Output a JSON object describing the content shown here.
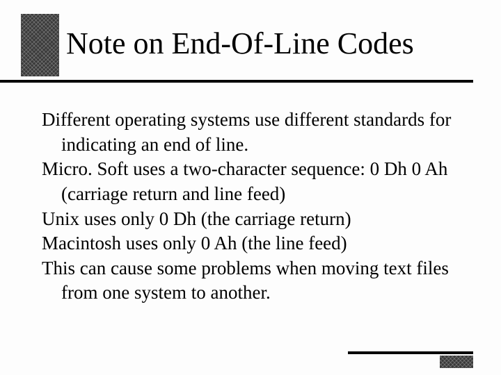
{
  "slide": {
    "title": "Note on End-Of-Line Codes",
    "paragraphs": [
      "Different operating systems use different standards for indicating an end of line.",
      "Micro. Soft uses a two-character sequence: 0 Dh 0 Ah (carriage return and line feed)",
      "Unix uses only 0 Dh (the carriage return)",
      "Macintosh uses only 0 Ah (the line feed)",
      "This can cause some problems when moving text files from one system to another."
    ]
  }
}
